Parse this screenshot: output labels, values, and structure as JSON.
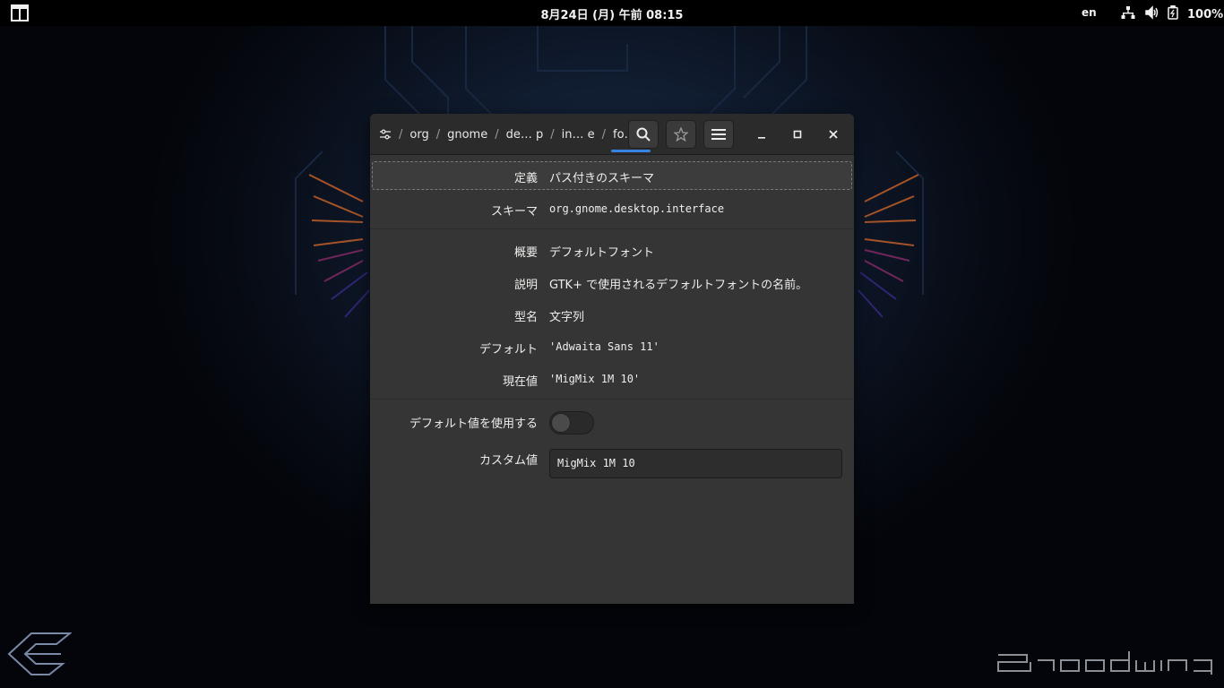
{
  "topbar": {
    "clock": "8月24日 (月) 午前 08:15",
    "language": "en",
    "battery": "100%"
  },
  "window": {
    "path": [
      "org",
      "gnome",
      "de… p",
      "in… e",
      "fo… e"
    ],
    "details": {
      "definition": {
        "label": "定義",
        "value": "パス付きのスキーマ"
      },
      "schema": {
        "label": "スキーマ",
        "value": "org.gnome.desktop.interface"
      },
      "summary": {
        "label": "概要",
        "value": "デフォルトフォント"
      },
      "description": {
        "label": "説明",
        "value": "GTK+ で使用されるデフォルトフォントの名前。"
      },
      "type": {
        "label": "型名",
        "value": "文字列"
      },
      "default": {
        "label": "デフォルト",
        "value": "'Adwaita Sans 11'"
      },
      "current": {
        "label": "現在値",
        "value": "'MigMix 1M 10'"
      }
    },
    "use_default": {
      "label": "デフォルト値を使用する",
      "on": false
    },
    "custom_value": {
      "label": "カスタム値",
      "value": "MigMix 1M 10"
    }
  },
  "colors": {
    "accent": "#3584e4",
    "window_bg": "#353535",
    "headerbar_bg": "#2b2b2b"
  }
}
